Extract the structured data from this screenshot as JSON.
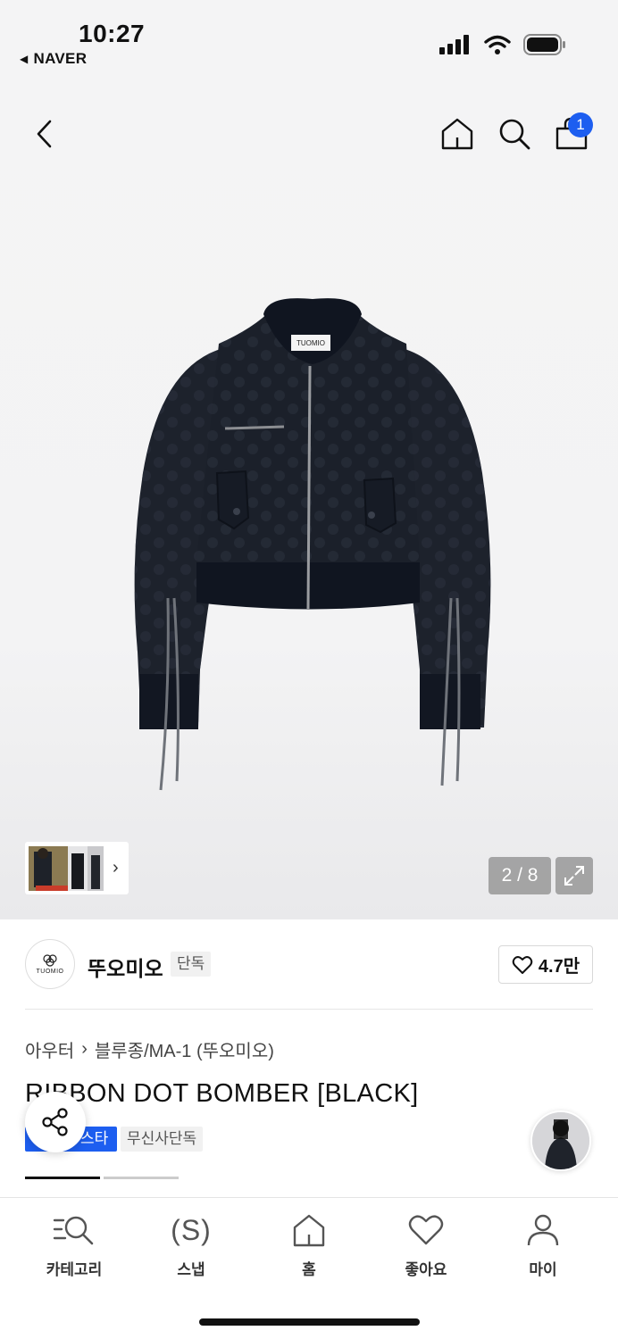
{
  "status_bar": {
    "time": "10:27",
    "back_app": "NAVER"
  },
  "header": {
    "cart_count": "1",
    "icons": [
      "back-icon",
      "home-icon",
      "search-icon",
      "cart-icon"
    ]
  },
  "gallery": {
    "counter": "2 / 8",
    "background_color": "#f4f4f5"
  },
  "brand": {
    "logo_text": "TUOMIO",
    "name": "뚜오미오",
    "tag": "단독",
    "like_count": "4.7만"
  },
  "breadcrumb": {
    "category": "아우터",
    "subcategory": "블루종/MA-1 (뚜오미오)"
  },
  "product": {
    "title": "RIBBON DOT BOMBER [BLACK]",
    "badge_blue": "스타",
    "badge_gray": "무신사단독",
    "accent_color": "#1d5ef0"
  },
  "tabbar": {
    "items": [
      {
        "label": "카테고리",
        "icon": "category-search-icon"
      },
      {
        "label": "스냅",
        "icon": "snap-icon"
      },
      {
        "label": "홈",
        "icon": "home-icon"
      },
      {
        "label": "좋아요",
        "icon": "heart-icon"
      },
      {
        "label": "마이",
        "icon": "person-icon"
      }
    ]
  }
}
